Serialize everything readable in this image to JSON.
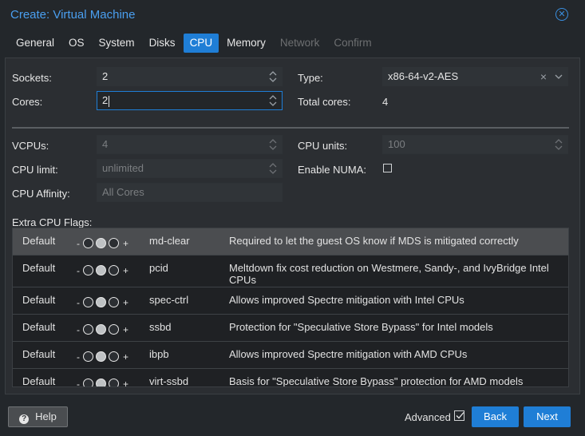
{
  "window": {
    "title": "Create: Virtual Machine"
  },
  "tabs": [
    {
      "label": "General",
      "state": "normal"
    },
    {
      "label": "OS",
      "state": "normal"
    },
    {
      "label": "System",
      "state": "normal"
    },
    {
      "label": "Disks",
      "state": "normal"
    },
    {
      "label": "CPU",
      "state": "active"
    },
    {
      "label": "Memory",
      "state": "normal"
    },
    {
      "label": "Network",
      "state": "disabled"
    },
    {
      "label": "Confirm",
      "state": "disabled"
    }
  ],
  "cpu": {
    "sockets": {
      "label": "Sockets:",
      "value": "2"
    },
    "cores": {
      "label": "Cores:",
      "value": "2"
    },
    "type": {
      "label": "Type:",
      "value": "x86-64-v2-AES"
    },
    "total_cores": {
      "label": "Total cores:",
      "value": "4"
    },
    "vcpus": {
      "label": "VCPUs:",
      "value": "4"
    },
    "cpu_units": {
      "label": "CPU units:",
      "value": "100"
    },
    "cpu_limit": {
      "label": "CPU limit:",
      "value": "unlimited"
    },
    "enable_numa": {
      "label": "Enable NUMA:",
      "checked": false
    },
    "cpu_affinity": {
      "label": "CPU Affinity:",
      "placeholder": "All Cores"
    }
  },
  "flags": {
    "label": "Extra CPU Flags:",
    "rows": [
      {
        "state": "Default",
        "name": "md-clear",
        "desc": "Required to let the guest OS know if MDS is mitigated correctly",
        "selected": true
      },
      {
        "state": "Default",
        "name": "pcid",
        "desc": "Meltdown fix cost reduction on Westmere, Sandy-, and IvyBridge Intel CPUs",
        "selected": false
      },
      {
        "state": "Default",
        "name": "spec-ctrl",
        "desc": "Allows improved Spectre mitigation with Intel CPUs",
        "selected": false
      },
      {
        "state": "Default",
        "name": "ssbd",
        "desc": "Protection for \"Speculative Store Bypass\" for Intel models",
        "selected": false
      },
      {
        "state": "Default",
        "name": "ibpb",
        "desc": "Allows improved Spectre mitigation with AMD CPUs",
        "selected": false
      },
      {
        "state": "Default",
        "name": "virt-ssbd",
        "desc": "Basis for \"Speculative Store Bypass\" protection for AMD models",
        "selected": false
      }
    ],
    "minus_symbol": "-",
    "plus_symbol": "+"
  },
  "footer": {
    "help_label": "Help",
    "advanced_label": "Advanced",
    "advanced_checked": true,
    "back_label": "Back",
    "next_label": "Next"
  },
  "colors": {
    "accent": "#1f7ed6",
    "title": "#4a9ff0",
    "background": "#23272b"
  }
}
